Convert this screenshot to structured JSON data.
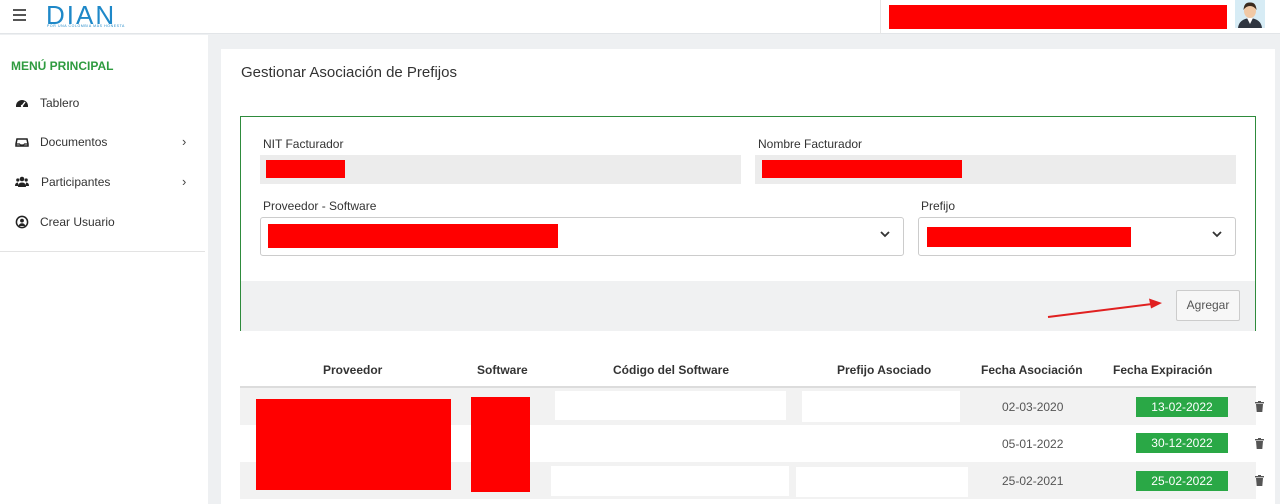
{
  "header": {
    "logo_text": "DIAN",
    "logo_tagline": "POR UNA COLOMBIA MÁS HONESTA"
  },
  "sidebar": {
    "title": "MENÚ PRINCIPAL",
    "items": [
      {
        "label": "Tablero",
        "icon": "dashboard-icon",
        "has_submenu": false
      },
      {
        "label": "Documentos",
        "icon": "inbox-icon",
        "has_submenu": true
      },
      {
        "label": "Participantes",
        "icon": "users-icon",
        "has_submenu": true
      },
      {
        "label": "Crear Usuario",
        "icon": "user-circle-icon",
        "has_submenu": false
      }
    ],
    "chevron": "›"
  },
  "main": {
    "title": "Gestionar Asociación de Prefijos",
    "form": {
      "nit_label": "NIT Facturador",
      "nombre_label": "Nombre Facturador",
      "proveedor_label": "Proveedor - Software",
      "prefijo_label": "Prefijo",
      "add_button": "Agregar"
    },
    "table": {
      "headers": [
        "Proveedor",
        "Software",
        "Código del Software",
        "Prefijo Asociado",
        "Fecha Asociación",
        "Fecha Expiración"
      ],
      "rows": [
        {
          "fecha_asociacion": "02-03-2020",
          "fecha_expiracion": "13-02-2022"
        },
        {
          "fecha_asociacion": "05-01-2022",
          "fecha_expiracion": "30-12-2022"
        },
        {
          "fecha_asociacion": "25-02-2021",
          "fecha_expiracion": "25-02-2022"
        }
      ]
    }
  },
  "colors": {
    "accent_green": "#2e9b3f",
    "badge_green": "#2aa846",
    "brand_blue": "#1e88c8",
    "redaction": "#ff0000",
    "annotation_arrow": "#e02020"
  }
}
